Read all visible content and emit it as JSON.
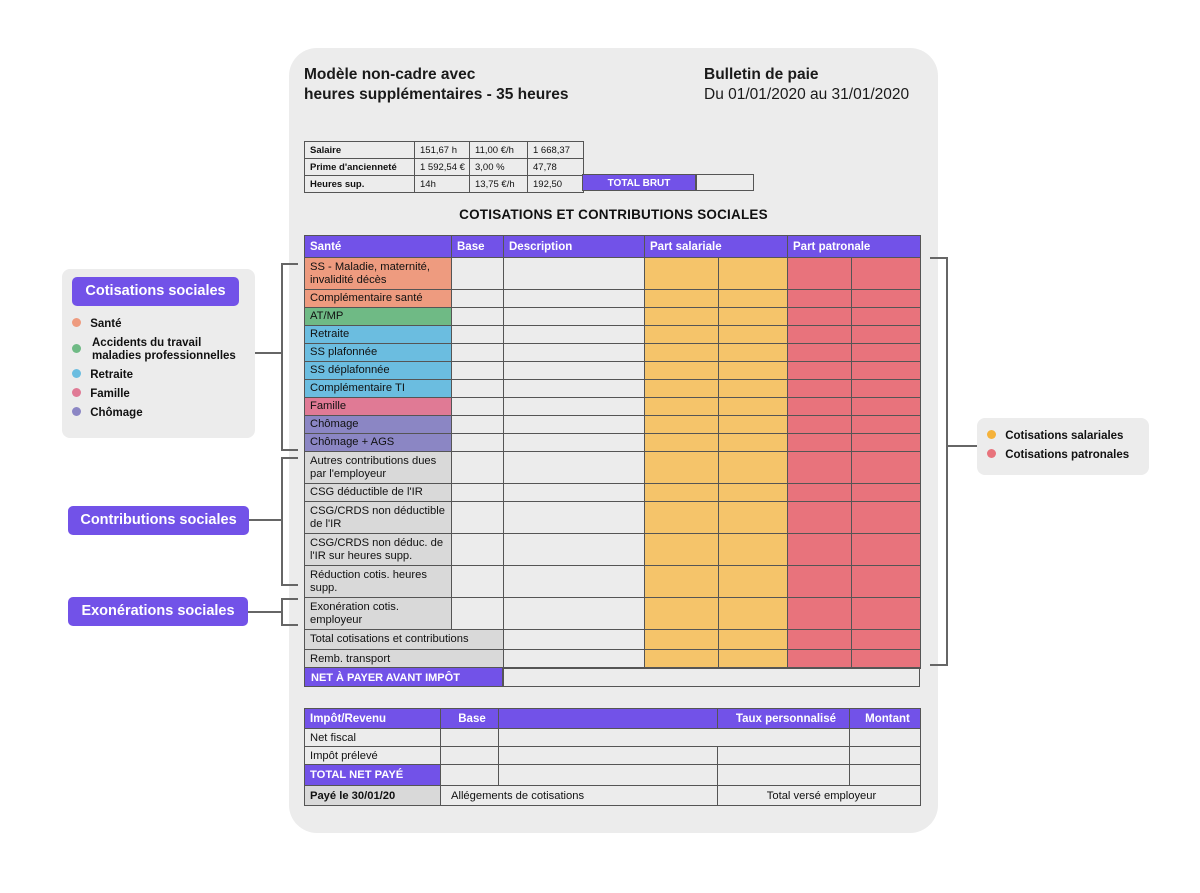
{
  "header": {
    "title_line1": "Modèle non-cadre avec",
    "title_line2": "heures supplémentaires - 35 heures",
    "doc_title": "Bulletin de paie",
    "period": "Du 01/01/2020 au 31/01/2020"
  },
  "salary_table": {
    "rows": [
      {
        "label": "Salaire",
        "c1": "151,67 h",
        "c2": "11,00 €/h",
        "c3": "1 668,37"
      },
      {
        "label": "Prime d'ancienneté",
        "c1": "1 592,54 €",
        "c2": "3,00 %",
        "c3": "47,78"
      },
      {
        "label": "Heures sup.",
        "c1": "14h",
        "c2": "13,75 €/h",
        "c3": "192,50"
      }
    ],
    "total_label": "TOTAL BRUT"
  },
  "section_title": "COTISATIONS ET CONTRIBUTIONS SOCIALES",
  "main_table": {
    "headers": {
      "col1": "Santé",
      "col2": "Base",
      "col3": "Description",
      "col4": "Part salariale",
      "col5": "Part patronale"
    },
    "rows": [
      "SS - Maladie, maternité, invalidité décès",
      "Complémentaire santé",
      "AT/MP",
      "Retraite",
      "SS plafonnée",
      "SS déplafonnée",
      "Complémentaire TI",
      "Famille",
      "Chômage",
      "Chômage + AGS",
      "Autres contributions dues par l'employeur",
      "CSG déductible de l'IR",
      "CSG/CRDS non déductible de l'IR",
      "CSG/CRDS non déduc. de l'IR sur heures supp.",
      "Réduction cotis. heures supp.",
      "Exonération cotis. employeur",
      "Total cotisations et contributions",
      "Remb. transport"
    ],
    "net_label": "NET À PAYER AVANT IMPÔT"
  },
  "tax_table": {
    "headers": {
      "col1": "Impôt/Revenu",
      "col2": "Base",
      "col3": "",
      "col4": "Taux personnalisé",
      "col5": "Montant"
    },
    "row1": "Net fiscal",
    "row2": "Impôt prélevé",
    "row3": "TOTAL NET PAYÉ",
    "paid": "Payé le 30/01/20",
    "allegements": "Allégements de cotisations",
    "total_employer": "Total versé employeur"
  },
  "left_panel": {
    "pill": "Cotisations sociales",
    "items": [
      {
        "label": "Santé",
        "color": "#ee9b7f"
      },
      {
        "label": "Accidents du travail maladies professionnelles",
        "color": "#6fba85"
      },
      {
        "label": "Retraite",
        "color": "#6bbde0"
      },
      {
        "label": "Famille",
        "color": "#e07a95"
      },
      {
        "label": "Chômage",
        "color": "#8b86c4"
      }
    ]
  },
  "contributions_pill": "Contributions sociales",
  "exonerations_pill": "Exonérations sociales",
  "right_panel": {
    "items": [
      {
        "label": "Cotisations salariales",
        "color": "#f5b23a"
      },
      {
        "label": "Cotisations patronales",
        "color": "#e8737c"
      }
    ]
  }
}
